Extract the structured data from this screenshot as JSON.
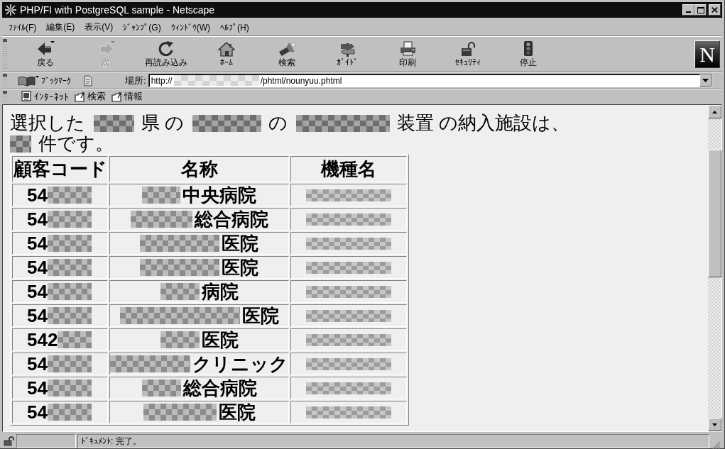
{
  "window": {
    "title": "PHP/FI with PostgreSQL sample - Netscape"
  },
  "menu_bar": [
    "ﾌｧｲﾙ(F)",
    "編集(E)",
    "表示(V)",
    "ｼﾞｬﾝﾌﾟ(G)",
    "ｳｨﾝﾄﾞｳ(W)",
    "ﾍﾙﾌﾟ(H)"
  ],
  "navigation_toolbar": {
    "buttons": [
      {
        "kind": "back",
        "label": "戻る",
        "disabled": false
      },
      {
        "kind": "forward",
        "label": "次",
        "disabled": true
      },
      {
        "kind": "reload",
        "label": "再読み込み",
        "disabled": false
      },
      {
        "kind": "home",
        "label": "ﾎｰﾑ",
        "disabled": false
      },
      {
        "kind": "search",
        "label": "検索",
        "disabled": false
      },
      {
        "kind": "guide",
        "label": "ｶﾞｲﾄﾞ",
        "disabled": false
      },
      {
        "kind": "print",
        "label": "印刷",
        "disabled": false
      },
      {
        "kind": "security",
        "label": "ｾｷｭﾘﾃｨ",
        "disabled": false
      },
      {
        "kind": "stop",
        "label": "停止",
        "disabled": false
      }
    ],
    "logo": "N"
  },
  "location_toolbar": {
    "bookmarks": "ﾌﾞｯｸﾏｰｸ",
    "location_label": "場所:",
    "url": [
      {
        "kind": "text",
        "text": "http://"
      },
      {
        "kind": "redacted"
      },
      {
        "kind": "text",
        "text": "/phtml/nounyuu.phtml"
      }
    ]
  },
  "personal_toolbar": [
    {
      "kind": "page",
      "label": "ｲﾝﾀｰﾈｯﾄ"
    },
    {
      "kind": "folder",
      "label": "検索"
    },
    {
      "kind": "folder",
      "label": "情報"
    }
  ],
  "page": {
    "heading_lines": [
      [
        {
          "kind": "text",
          "text": "選択した"
        },
        {
          "kind": "redacted"
        },
        {
          "kind": "text",
          "text": "県 の"
        },
        {
          "kind": "redacted"
        },
        {
          "kind": "text",
          "text": "の"
        },
        {
          "kind": "redacted"
        },
        {
          "kind": "text",
          "text": "装置 の納入施設は、"
        }
      ],
      [
        {
          "kind": "redacted"
        },
        {
          "kind": "text",
          "text": "件です。"
        }
      ]
    ],
    "table": {
      "columns": [
        "顧客コード",
        "名称",
        "機種名"
      ],
      "rows": [
        {
          "cells": [
            [
              {
                "kind": "text",
                "text": "54"
              },
              {
                "kind": "redacted"
              }
            ],
            [
              {
                "kind": "redacted"
              },
              {
                "kind": "text",
                "text": "中央病院"
              }
            ],
            [
              {
                "kind": "redacted"
              }
            ]
          ]
        },
        {
          "cells": [
            [
              {
                "kind": "text",
                "text": "54"
              },
              {
                "kind": "redacted"
              }
            ],
            [
              {
                "kind": "redacted"
              },
              {
                "kind": "text",
                "text": "総合病院"
              }
            ],
            [
              {
                "kind": "redacted"
              }
            ]
          ]
        },
        {
          "cells": [
            [
              {
                "kind": "text",
                "text": "54"
              },
              {
                "kind": "redacted"
              }
            ],
            [
              {
                "kind": "redacted"
              },
              {
                "kind": "text",
                "text": "医院"
              }
            ],
            [
              {
                "kind": "redacted"
              }
            ]
          ]
        },
        {
          "cells": [
            [
              {
                "kind": "text",
                "text": "54"
              },
              {
                "kind": "redacted"
              }
            ],
            [
              {
                "kind": "redacted"
              },
              {
                "kind": "text",
                "text": "医院"
              }
            ],
            [
              {
                "kind": "redacted"
              }
            ]
          ]
        },
        {
          "cells": [
            [
              {
                "kind": "text",
                "text": "54"
              },
              {
                "kind": "redacted"
              }
            ],
            [
              {
                "kind": "redacted"
              },
              {
                "kind": "text",
                "text": "病院"
              }
            ],
            [
              {
                "kind": "redacted"
              }
            ]
          ]
        },
        {
          "cells": [
            [
              {
                "kind": "text",
                "text": "54"
              },
              {
                "kind": "redacted"
              }
            ],
            [
              {
                "kind": "redacted"
              },
              {
                "kind": "text",
                "text": "医院"
              }
            ],
            [
              {
                "kind": "redacted"
              }
            ]
          ]
        },
        {
          "cells": [
            [
              {
                "kind": "text",
                "text": "542"
              },
              {
                "kind": "redacted"
              }
            ],
            [
              {
                "kind": "redacted"
              },
              {
                "kind": "text",
                "text": "医院"
              }
            ],
            [
              {
                "kind": "redacted"
              }
            ]
          ]
        },
        {
          "cells": [
            [
              {
                "kind": "text",
                "text": "54"
              },
              {
                "kind": "redacted"
              }
            ],
            [
              {
                "kind": "redacted"
              },
              {
                "kind": "text",
                "text": "クリニック"
              }
            ],
            [
              {
                "kind": "redacted"
              }
            ]
          ]
        },
        {
          "cells": [
            [
              {
                "kind": "text",
                "text": "54"
              },
              {
                "kind": "redacted"
              }
            ],
            [
              {
                "kind": "redacted"
              },
              {
                "kind": "text",
                "text": "総合病院"
              }
            ],
            [
              {
                "kind": "redacted"
              }
            ]
          ]
        },
        {
          "cells": [
            [
              {
                "kind": "text",
                "text": "54"
              },
              {
                "kind": "redacted"
              }
            ],
            [
              {
                "kind": "redacted"
              },
              {
                "kind": "text",
                "text": "医院"
              }
            ],
            [
              {
                "kind": "redacted"
              }
            ]
          ]
        }
      ]
    }
  },
  "status_bar": {
    "text": "ﾄﾞｷｭﾒﾝﾄ: 完了。"
  }
}
